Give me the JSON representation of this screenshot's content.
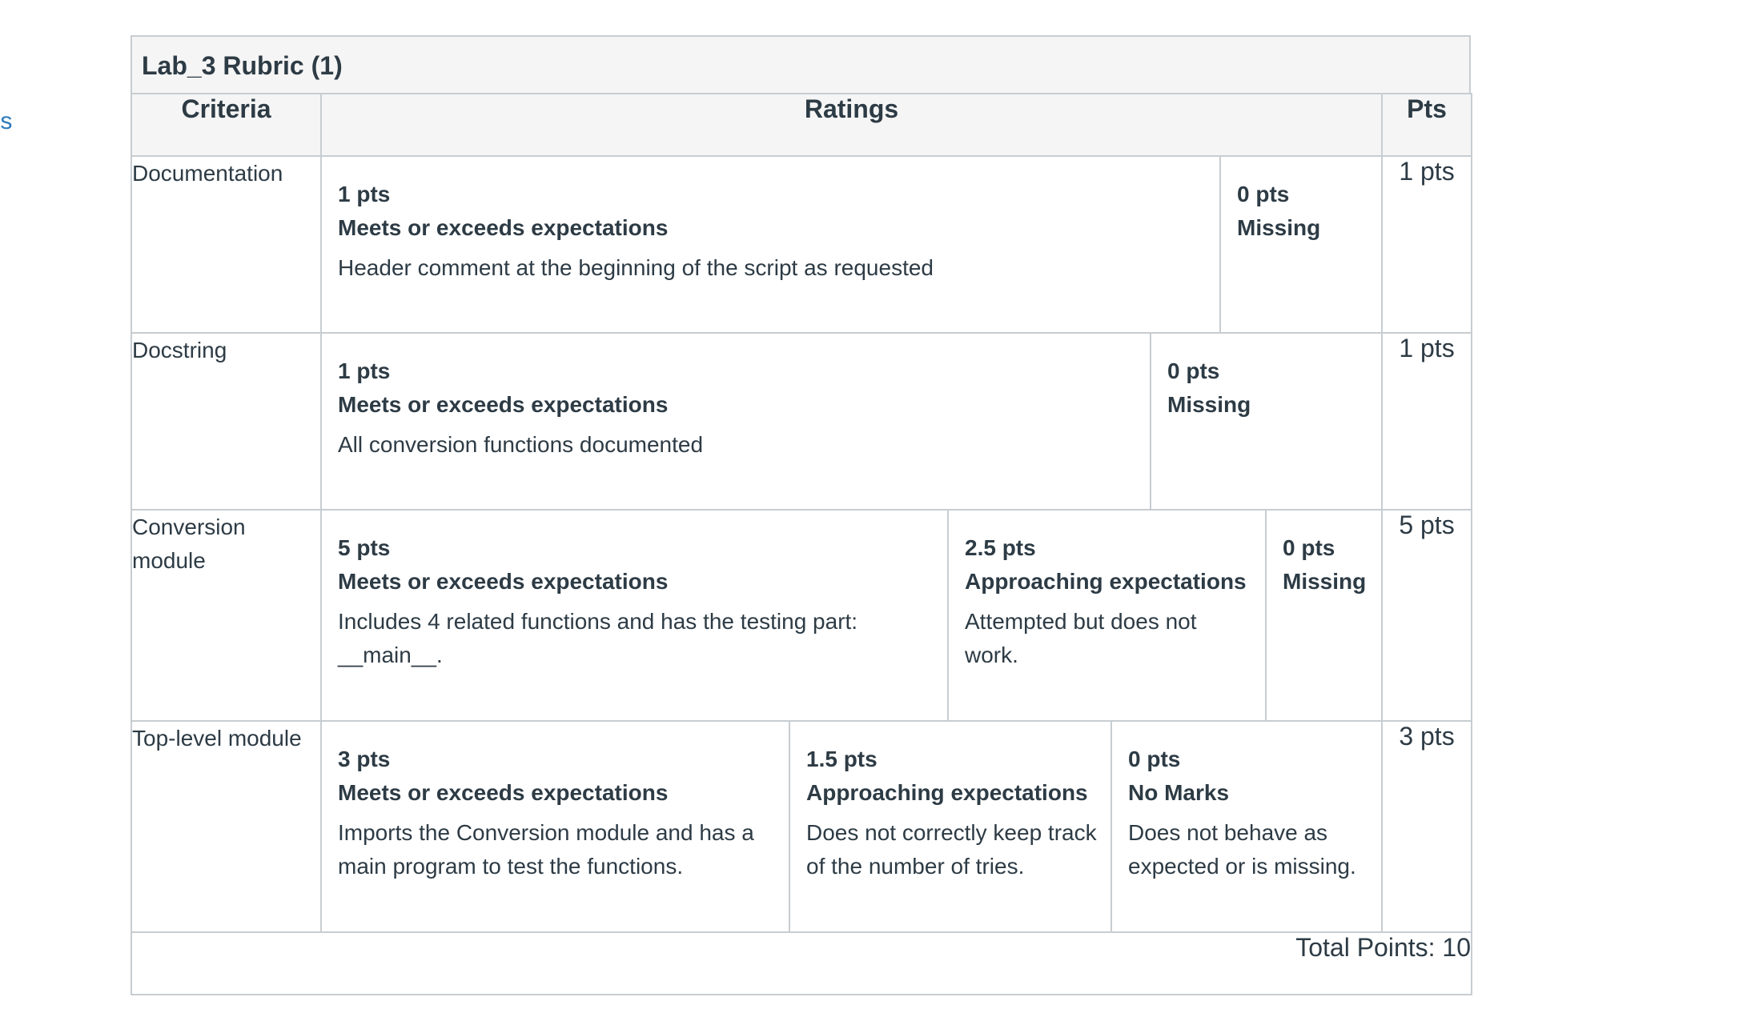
{
  "side_link": "ts",
  "rubric": {
    "title": "Lab_3 Rubric (1)",
    "headers": {
      "criteria": "Criteria",
      "ratings": "Ratings",
      "pts": "Pts"
    },
    "rows": [
      {
        "criterion": "Documentation",
        "points": "1 pts",
        "ratings": [
          {
            "pts": "1 pts",
            "title": "Meets or exceeds expectations",
            "desc": "Header comment at the beginning of the script as requested"
          },
          {
            "pts": "0 pts",
            "title": "Missing",
            "desc": ""
          }
        ]
      },
      {
        "criterion": "Docstring",
        "points": "1 pts",
        "ratings": [
          {
            "pts": "1 pts",
            "title": "Meets or exceeds expectations",
            "desc": "All conversion functions documented"
          },
          {
            "pts": "0 pts",
            "title": "Missing",
            "desc": ""
          }
        ]
      },
      {
        "criterion": "Conversion module",
        "points": "5 pts",
        "ratings": [
          {
            "pts": "5 pts",
            "title": "Meets or exceeds expectations",
            "desc": "Includes 4 related functions and has the testing part: __main__."
          },
          {
            "pts": "2.5 pts",
            "title": "Approaching expectations",
            "desc": "Attempted but does not work."
          },
          {
            "pts": "0 pts",
            "title": "Missing",
            "desc": ""
          }
        ]
      },
      {
        "criterion": "Top-level module",
        "points": "3 pts",
        "ratings": [
          {
            "pts": "3 pts",
            "title": "Meets or exceeds expectations",
            "desc": "Imports the Conversion module and has a main program to test the functions."
          },
          {
            "pts": "1.5 pts",
            "title": "Approaching expectations",
            "desc": "Does not correctly keep track of the number of tries."
          },
          {
            "pts": "0 pts",
            "title": "No Marks",
            "desc": "Does not behave as expected or is missing."
          }
        ]
      }
    ],
    "total": "Total Points: 10"
  }
}
